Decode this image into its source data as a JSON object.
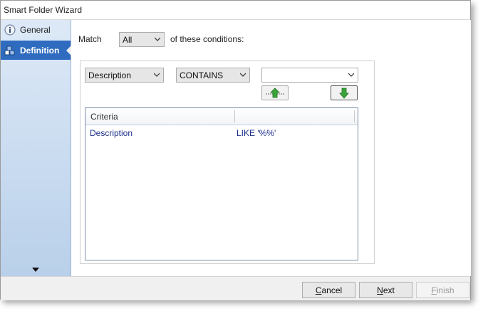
{
  "window": {
    "title": "Smart Folder Wizard"
  },
  "sidebar": {
    "items": [
      {
        "label": "General",
        "icon": "info-icon",
        "active": false
      },
      {
        "label": "Definition",
        "icon": "blocks-icon",
        "active": true
      }
    ]
  },
  "match": {
    "label": "Match",
    "selected": "All",
    "suffix": "of these conditions:"
  },
  "condition": {
    "field": "Description",
    "operator": "CONTAINS",
    "value": ""
  },
  "grid": {
    "columns": [
      "Criteria",
      ""
    ],
    "rows": [
      {
        "field": "Description",
        "expression": "LIKE '%%'"
      }
    ]
  },
  "footer": {
    "cancel": "Cancel",
    "next": "Next",
    "finish": "Finish"
  },
  "colors": {
    "accent": "#2f6cc0",
    "grid_text": "#1a2e8a",
    "add_arrow": "#3aa63a",
    "down_arrow": "#3aa63a"
  }
}
